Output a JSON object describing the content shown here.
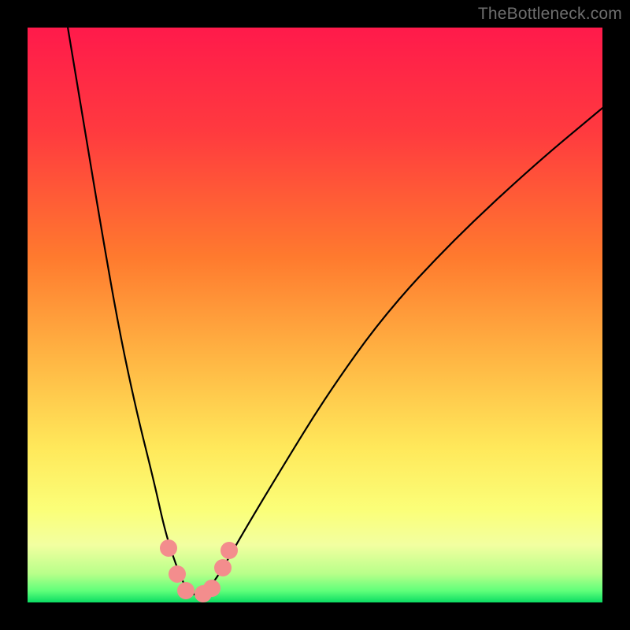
{
  "watermark": {
    "text": "TheBottleneck.com"
  },
  "chart_data": {
    "type": "line",
    "title": "",
    "xlabel": "",
    "ylabel": "",
    "xlim": [
      0,
      100
    ],
    "ylim": [
      0,
      100
    ],
    "grid": false,
    "gradient_stops": [
      {
        "offset": 0,
        "color": "#ff1a4b"
      },
      {
        "offset": 18,
        "color": "#ff3a3f"
      },
      {
        "offset": 40,
        "color": "#ff7a2e"
      },
      {
        "offset": 58,
        "color": "#ffb744"
      },
      {
        "offset": 73,
        "color": "#ffe85a"
      },
      {
        "offset": 84,
        "color": "#fbff79"
      },
      {
        "offset": 90,
        "color": "#f2ffa0"
      },
      {
        "offset": 95,
        "color": "#b8ff8a"
      },
      {
        "offset": 98,
        "color": "#5fff7a"
      },
      {
        "offset": 100,
        "color": "#0bdc63"
      }
    ],
    "series": [
      {
        "name": "bottleneck-curve",
        "color": "#000000",
        "width": 2.2,
        "x": [
          7,
          10,
          13,
          16,
          19,
          22,
          24,
          26,
          27.5,
          29,
          30.5,
          32,
          34,
          38,
          44,
          52,
          62,
          74,
          88,
          100
        ],
        "values": [
          100,
          82,
          64,
          47,
          33,
          21,
          12,
          6,
          2.5,
          1.2,
          1.5,
          3,
          6,
          13,
          23,
          36,
          50,
          63,
          76,
          86
        ]
      }
    ],
    "markers": {
      "color": "#f38d8d",
      "points": [
        {
          "x": 24.5,
          "y": 9.5
        },
        {
          "x": 26.0,
          "y": 5.0
        },
        {
          "x": 27.5,
          "y": 2.0
        },
        {
          "x": 30.5,
          "y": 1.5
        },
        {
          "x": 32.0,
          "y": 2.5
        },
        {
          "x": 34.0,
          "y": 6.0
        },
        {
          "x": 35.0,
          "y": 9.0
        }
      ]
    }
  }
}
